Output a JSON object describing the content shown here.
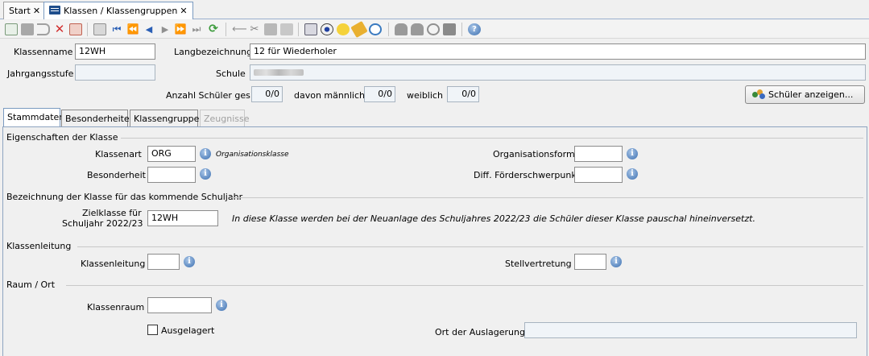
{
  "doc_tabs": [
    {
      "label": "Start"
    },
    {
      "label": "Klassen / Klassengruppen"
    }
  ],
  "header": {
    "klassenname_label": "Klassenname",
    "klassenname_value": "12WH",
    "langbezeichnung_label": "Langbezeichnung",
    "langbezeichnung_value": "12 für Wiederholer",
    "jahrgangsstufe_label": "Jahrgangsstufe",
    "jahrgangsstufe_value": "",
    "schule_label": "Schule",
    "anzahl_label": "Anzahl Schüler ges.",
    "anzahl_value": "0/0",
    "maennlich_label": "davon männlich",
    "maennlich_value": "0/0",
    "weiblich_label": "weiblich",
    "weiblich_value": "0/0",
    "schueler_button": "Schüler anzeigen..."
  },
  "page_tabs": [
    {
      "label": "Stammdaten"
    },
    {
      "label": "Besonderheiten"
    },
    {
      "label": "Klassengruppen"
    },
    {
      "label": "Zeugnisse"
    }
  ],
  "eigenschaften": {
    "title": "Eigenschaften der Klasse",
    "klassenart_label": "Klassenart",
    "klassenart_value": "ORG",
    "klassenart_hint": "Organisationsklasse",
    "besonderheit_label": "Besonderheit",
    "besonderheit_value": "",
    "organisationsform_label": "Organisationsform",
    "organisationsform_value": "",
    "foerder_label": "Diff. Förderschwerpunkt",
    "foerder_value": ""
  },
  "bezeichnung": {
    "title": "Bezeichnung der Klasse für das kommende Schuljahr",
    "ziel_label_1": "Zielklasse für",
    "ziel_label_2": "Schuljahr 2022/23",
    "ziel_value": "12WH",
    "hint": "In diese Klasse werden bei der Neuanlage des Schuljahres 2022/23 die Schüler dieser Klasse pauschal hineinversetzt."
  },
  "klassenleitung": {
    "title": "Klassenleitung",
    "klassenleitung_label": "Klassenleitung",
    "klassenleitung_value": "",
    "stellvertretung_label": "Stellvertretung",
    "stellvertretung_value": ""
  },
  "raum": {
    "title": "Raum / Ort",
    "klassenraum_label": "Klassenraum",
    "klassenraum_value": "",
    "ausgelagert_label": "Ausgelagert",
    "ausgelagert_checked": false,
    "ort_label": "Ort der Auslagerung",
    "ort_value": ""
  },
  "info_glyph": "i",
  "toolbar_icons": [
    "new-icon",
    "save-icon",
    "undo-icon",
    "delete-icon",
    "cancel-icon",
    "copy-record-icon",
    "first-icon",
    "prev-page-icon",
    "prev-icon",
    "next-icon",
    "next-page-icon",
    "last-icon",
    "refresh-icon",
    "minus-icon",
    "cut-icon",
    "copy-icon",
    "paste-icon",
    "print-icon",
    "preview-icon",
    "bulb-icon",
    "clean-icon",
    "clock-icon",
    "group-icon",
    "person-icon",
    "tools-icon",
    "disk-icon",
    "help-icon"
  ]
}
